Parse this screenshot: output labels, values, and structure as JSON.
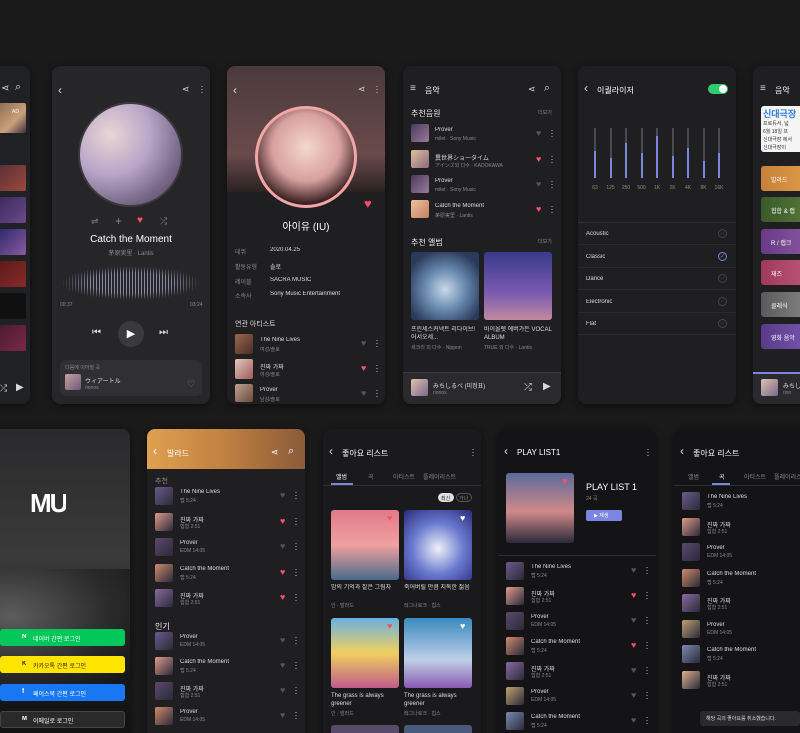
{
  "colors": {
    "bg": "#1a1a1b",
    "card": "#222326",
    "accent_pink": "#ff4d6d",
    "accent_green": "#2ecc71",
    "eq_bar": "#7b86e0"
  },
  "screen0": {
    "thumb_badge": "AD"
  },
  "player": {
    "song_title": "Catch the Moment",
    "artist": "茅原実里 · Lantis",
    "time_elapsed": "00:37",
    "time_total": "03:24",
    "next_label": "다음에 이어질 곡",
    "next_song": "ウィアートル",
    "next_artist": "rionos"
  },
  "artist": {
    "name": "아이유 (IU)",
    "info": [
      {
        "k": "데뷔",
        "v": "2020.04.25"
      },
      {
        "k": "활동유형",
        "v": "솔로"
      },
      {
        "k": "레이블",
        "v": "SACRA MUSIC"
      },
      {
        "k": "소속사",
        "v": "Sony Music Entertainment"
      }
    ],
    "related_title": "연관 아티스트",
    "related": [
      {
        "name": "The Nine Lives",
        "sub": "여성/솔로"
      },
      {
        "name": "진짜 가짜",
        "sub": "여성/솔로"
      },
      {
        "name": "Prover",
        "sub": "남성/솔로"
      }
    ]
  },
  "music": {
    "title": "음악",
    "rec_songs_title": "추천음원",
    "more": "더보기",
    "songs": [
      {
        "t": "Prover",
        "s": "milet · Sony Music"
      },
      {
        "t": "異世界ショータイム",
        "s": "アインズ외 다수 · KADOKAWA"
      },
      {
        "t": "Prover",
        "s": "milet · Sony Music"
      },
      {
        "t": "Catch the Moment",
        "s": "茅原実里 · Lantis"
      }
    ],
    "rec_albums_title": "추천 앨범",
    "albums": [
      {
        "t": "프린세스커넥트 리다이브! 어서오세...",
        "s": "세크리 외 다수 · Nippon"
      },
      {
        "t": "바이올렛 에버가든 VOCAL ALBUM",
        "s": "TRUE 외 다수 · Lantis"
      }
    ],
    "mini_song": "みちしるべ (미정표)",
    "mini_artist": "rionos"
  },
  "eq": {
    "title": "이퀄라이저",
    "bands": [
      "63",
      "125",
      "250",
      "500",
      "1K",
      "2K",
      "4K",
      "8K",
      "16K"
    ],
    "levels": [
      0.55,
      0.4,
      0.7,
      0.5,
      0.85,
      0.45,
      0.6,
      0.35,
      0.5
    ],
    "presets": [
      "Acoustic",
      "Classic",
      "Dance",
      "Electronic",
      "Flat"
    ],
    "selected": "Classic"
  },
  "genre": {
    "title": "음악",
    "banner": [
      "신대극장",
      "프로듀서, 넓",
      "6월 18일 프",
      "신대극장 에서",
      "신대극장이"
    ],
    "items": [
      "발라드",
      "힙합 & 랩",
      "R / 랩크",
      "재즈",
      "클래식",
      "영화 음악"
    ],
    "mini": "みちし",
    "mini_sub": "rion"
  },
  "login": {
    "logo": "MU",
    "buttons": [
      {
        "label": "네이버 간편 로그인",
        "icon": "N"
      },
      {
        "label": "카카오톡 간편 로그인",
        "icon": "K"
      },
      {
        "label": "페이스북 간편 로그인",
        "icon": "f"
      },
      {
        "label": "이메일로 로그인",
        "icon": "M"
      }
    ]
  },
  "ballad": {
    "title": "발라드",
    "section1": "추천",
    "songs1": [
      {
        "t": "The Nine Lives",
        "s": "랩 5:24"
      },
      {
        "t": "진짜 가짜",
        "s": "힙합 2:51"
      },
      {
        "t": "Prover",
        "s": "EDM 14:05"
      },
      {
        "t": "Catch the Moment",
        "s": "랩 5:24"
      },
      {
        "t": "진짜 가짜",
        "s": "힙합 2:51"
      }
    ],
    "section2": "인기",
    "songs2": [
      {
        "t": "Prover",
        "s": "EDM 14:05"
      },
      {
        "t": "Catch the Moment",
        "s": "랩 5:24"
      },
      {
        "t": "진짜 가짜",
        "s": "힙합 2:51"
      },
      {
        "t": "Prover",
        "s": "EDM 14:05"
      }
    ]
  },
  "likes": {
    "title": "좋아요 리스트",
    "tabs": [
      "앨범",
      "곡",
      "아티스트",
      "플레이리스트"
    ],
    "pills": [
      "최신",
      "가나"
    ],
    "albums": [
      {
        "t": "밤의 기억과 짙은 그림자",
        "s": "인 · 발라드"
      },
      {
        "t": "죽어버릴 만큼 지독한 젊음",
        "s": "레그나로크 · 힙스"
      },
      {
        "t": "The grass is always greener",
        "s": "인 · 발라드"
      },
      {
        "t": "The grass is always greener",
        "s": "레그나로크 · 힙스"
      }
    ]
  },
  "playlist": {
    "title": "PLAY LIST1",
    "name": "PLAY LIST 1",
    "count": "24 곡",
    "play": "▶ 재생",
    "songs": [
      {
        "t": "The Nine Lives",
        "s": "랩 5:24"
      },
      {
        "t": "진짜 가짜",
        "s": "힙합 2:51"
      },
      {
        "t": "Prover",
        "s": "EDM 14:05"
      },
      {
        "t": "Catch the Moment",
        "s": "랩 5:24"
      },
      {
        "t": "진짜 가짜",
        "s": "힙합 2:51"
      },
      {
        "t": "Prover",
        "s": "EDM 14:05"
      },
      {
        "t": "Catch the Moment",
        "s": "랩 5:24"
      }
    ]
  },
  "likes2": {
    "title": "좋아요 리스트",
    "tabs": [
      "앨범",
      "곡",
      "아티스트",
      "플레이리스트"
    ],
    "songs": [
      {
        "t": "The Nine Lives",
        "s": "랩 5:24"
      },
      {
        "t": "진짜 가짜",
        "s": "힙합 2:51"
      },
      {
        "t": "Prover",
        "s": "EDM 14:05"
      },
      {
        "t": "Catch the Moment",
        "s": "랩 5:24"
      },
      {
        "t": "진짜 가짜",
        "s": "힙합 2:51"
      },
      {
        "t": "Prover",
        "s": "EDM 14:05"
      },
      {
        "t": "Catch the Moment",
        "s": "랩 5:24"
      },
      {
        "t": "진짜 가짜",
        "s": "힙합 2:51"
      }
    ],
    "toast": "해당 곡의 좋아요를 취소했습니다."
  }
}
